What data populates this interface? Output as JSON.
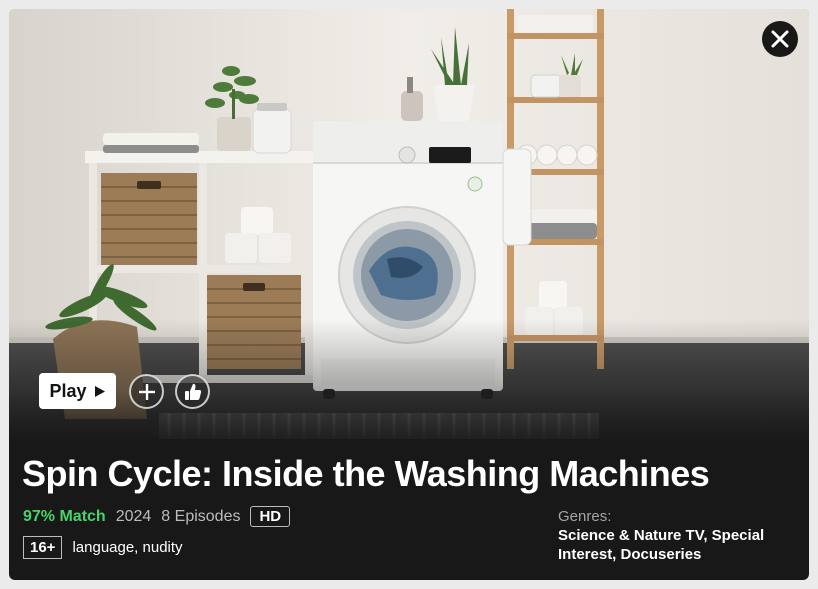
{
  "modal": {
    "title": "Spin Cycle: Inside the Washing Machines",
    "play_label": "Play",
    "match": "97% Match",
    "year": "2024",
    "episodes": "8 Episodes",
    "quality": "HD",
    "maturity_rating": "16+",
    "content_warnings": "language, nudity",
    "genres_label": "Genres:",
    "genres": "Science & Nature TV, Special Interest, Docuseries"
  },
  "icons": {
    "close": "close-icon",
    "play": "play-icon",
    "add": "plus-icon",
    "like": "thumbs-up-icon"
  },
  "colors": {
    "background": "#181818",
    "match": "#46d369",
    "text": "#ffffff",
    "muted": "#bcbcbc"
  }
}
